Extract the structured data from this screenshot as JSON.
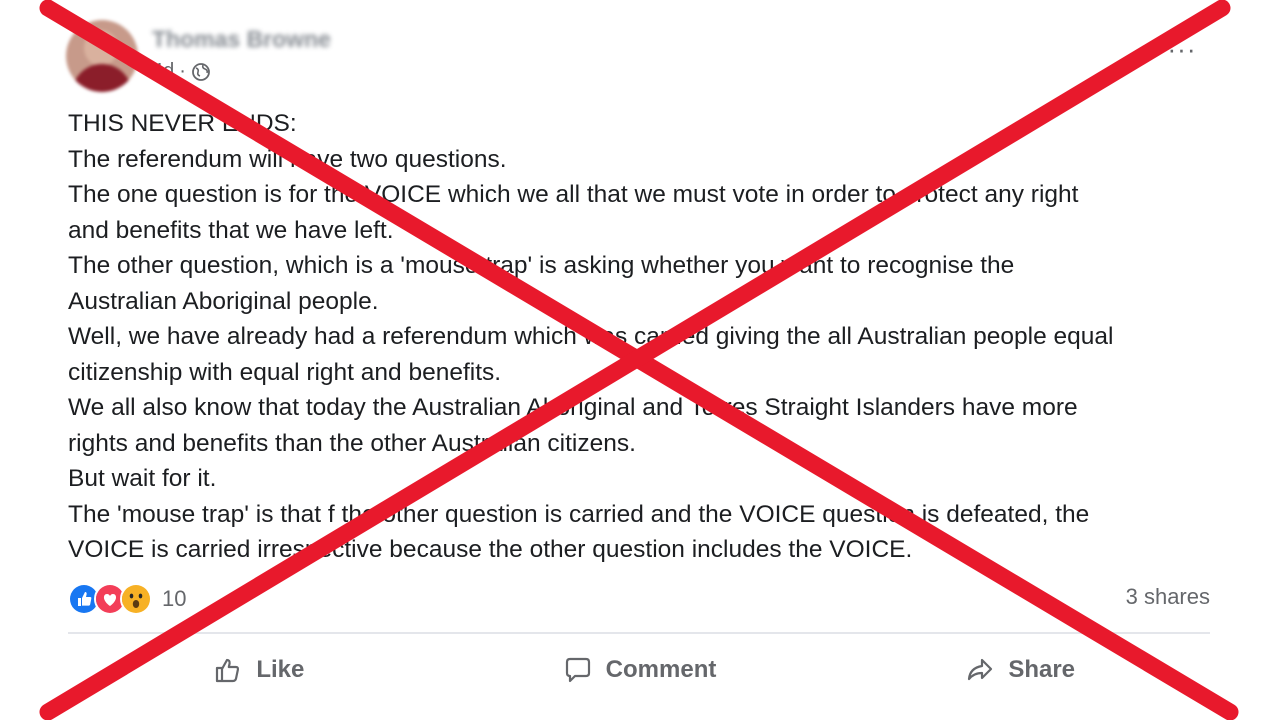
{
  "post": {
    "author": "Thomas Browne",
    "timestamp": "4d",
    "separator": "·",
    "visibility_icon": "globe-icon",
    "more_icon": "more-options-icon",
    "more_label": "···",
    "lines": [
      "THIS NEVER ENDS:",
      "The referendum will have two questions.",
      "The one question is for the VOICE which we all that we must vote in order to protect any right",
      "and benefits that we have left.",
      "The other question, which is a 'mouse trap' is asking whether you want to recognise the",
      "Australian Aboriginal people.",
      "Well, we have already had a referendum which was carried giving the all Australian people equal",
      "citizenship with equal right and benefits.",
      "We all also know that today the Australian Aboriginal and Torres Straight Islanders have more",
      "rights and benefits than the other Australian citizens.",
      "But wait for it.",
      "The 'mouse trap' is that f the other question is carried and the VOICE question is defeated, the",
      "VOICE is carried irrespective because the other question includes the VOICE."
    ]
  },
  "reactions": {
    "icons": [
      "like-reaction-icon",
      "love-reaction-icon",
      "wow-reaction-icon"
    ],
    "count": "10",
    "shares": "3 shares"
  },
  "actions": {
    "like": "Like",
    "comment": "Comment",
    "share": "Share"
  },
  "overlay": {
    "type": "red-x-cross",
    "color": "#e8192c"
  }
}
